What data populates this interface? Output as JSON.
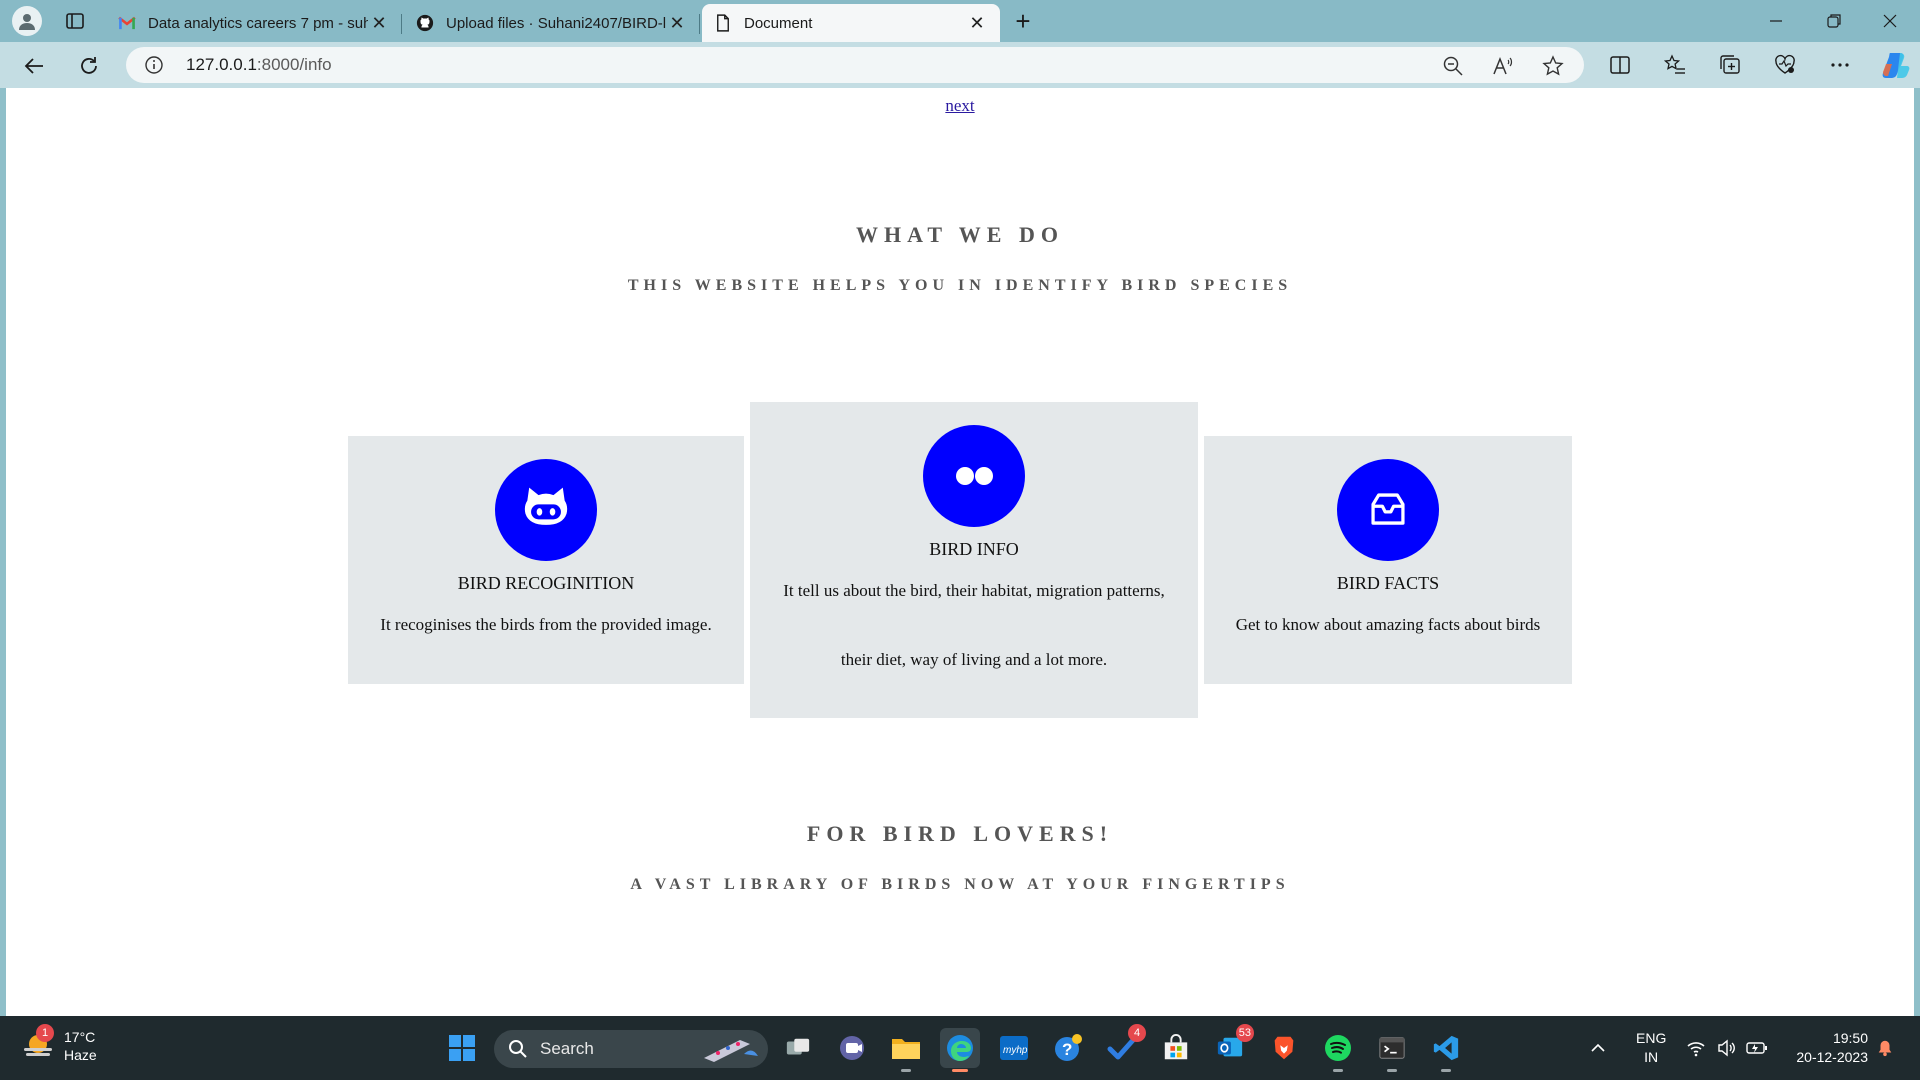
{
  "browser": {
    "tabs": [
      {
        "title": "Data analytics careers 7 pm - suh",
        "favicon": "gmail-icon",
        "active": false
      },
      {
        "title": "Upload files · Suhani2407/BIRD-l",
        "favicon": "github-icon",
        "active": false
      },
      {
        "title": "Document",
        "favicon": "document-icon",
        "active": true
      }
    ],
    "address": {
      "host": "127.0.0.1",
      "path": ":8000/info"
    }
  },
  "page": {
    "next_link": "next",
    "section1": {
      "title": "WHAT WE DO",
      "subtitle": "THIS WEBSITE HELPS YOU IN IDENTIFY BIRD SPECIES"
    },
    "cards": [
      {
        "icon": "github-icon",
        "title": "BIRD RECOGINITION",
        "description": "It recoginises the birds from the provided image."
      },
      {
        "icon": "flickr-icon",
        "title": "BIRD INFO",
        "description": "It tell us about the bird, their habitat, migration patterns, their diet, way of living and a lot more."
      },
      {
        "icon": "inbox-icon",
        "title": "BIRD FACTS",
        "description": "Get to know about amazing facts about birds"
      }
    ],
    "section2": {
      "title": "FOR BIRD LOVERS!",
      "subtitle": "A VAST LIBRARY OF BIRDS NOW AT YOUR FINGERTIPS"
    },
    "accent_color": "#0000ff",
    "card_bg": "#e4e8ea"
  },
  "taskbar": {
    "weather": {
      "temp": "17°C",
      "condition": "Haze",
      "badge": "1"
    },
    "search_label": "Search",
    "badges": {
      "todo": "4",
      "outlook": "53"
    },
    "tray": {
      "lang": "ENG",
      "region": "IN",
      "time": "19:50",
      "date": "20-12-2023"
    }
  }
}
